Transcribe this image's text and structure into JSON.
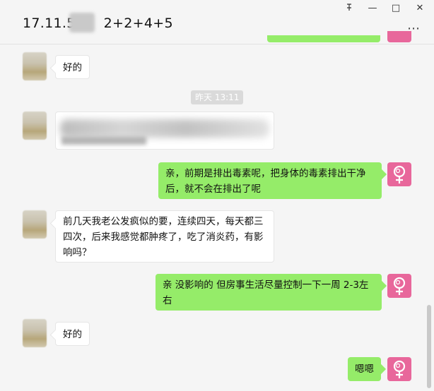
{
  "header": {
    "title": "17.11.5",
    "title_suffix": "2+2+4+5",
    "pin_glyph": "pin-icon",
    "minimize_glyph": "—",
    "maximize_glyph": "□",
    "close_glyph": "✕",
    "more_glyph": "⋯"
  },
  "timestamp": "昨天 13:11",
  "messages": [
    {
      "side": "left",
      "text": "好的"
    },
    {
      "side": "left",
      "text": "",
      "blurred": true
    },
    {
      "side": "right",
      "text": "亲，前期是排出毒素呢，把身体的毒素排出干净后，就不会在排出了呢"
    },
    {
      "side": "left",
      "text": "前几天我老公发疯似的要，连续四天，每天都三四次，后来我感觉都肿疼了，吃了消炎药，有影响吗？"
    },
    {
      "side": "right",
      "text": "亲 没影响的 但房事生活尽量控制一下一周 2-3左右"
    },
    {
      "side": "left",
      "text": "好的"
    },
    {
      "side": "right",
      "text": "嗯嗯"
    }
  ],
  "colors": {
    "self_bubble": "#95ec69",
    "other_bubble": "#ffffff",
    "self_avatar": "#e8679b",
    "background": "#f5f5f5"
  }
}
